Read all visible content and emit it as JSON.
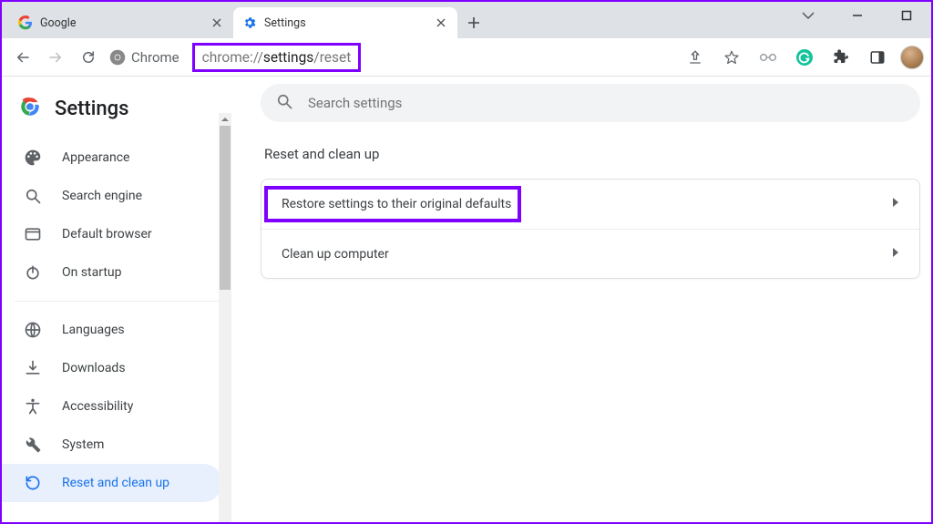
{
  "window": {
    "minimize": "−",
    "maximize": "▢",
    "chevron": "⌄"
  },
  "tabs": [
    {
      "title": "Google",
      "active": false
    },
    {
      "title": "Settings",
      "active": true
    }
  ],
  "toolbar": {
    "chrome_label": "Chrome",
    "url_seg1": "chrome://",
    "url_seg2": "settings",
    "url_seg3": "/reset"
  },
  "sidebar": {
    "title": "Settings",
    "items_a": [
      {
        "id": "appearance",
        "label": "Appearance"
      },
      {
        "id": "search-engine",
        "label": "Search engine"
      },
      {
        "id": "default-browser",
        "label": "Default browser"
      },
      {
        "id": "on-startup",
        "label": "On startup"
      }
    ],
    "items_b": [
      {
        "id": "languages",
        "label": "Languages"
      },
      {
        "id": "downloads",
        "label": "Downloads"
      },
      {
        "id": "accessibility",
        "label": "Accessibility"
      },
      {
        "id": "system",
        "label": "System"
      },
      {
        "id": "reset",
        "label": "Reset and clean up",
        "selected": true
      }
    ]
  },
  "main": {
    "search_placeholder": "Search settings",
    "section_title": "Reset and clean up",
    "rows": [
      {
        "id": "restore",
        "label": "Restore settings to their original defaults"
      },
      {
        "id": "cleanup",
        "label": "Clean up computer"
      }
    ]
  }
}
